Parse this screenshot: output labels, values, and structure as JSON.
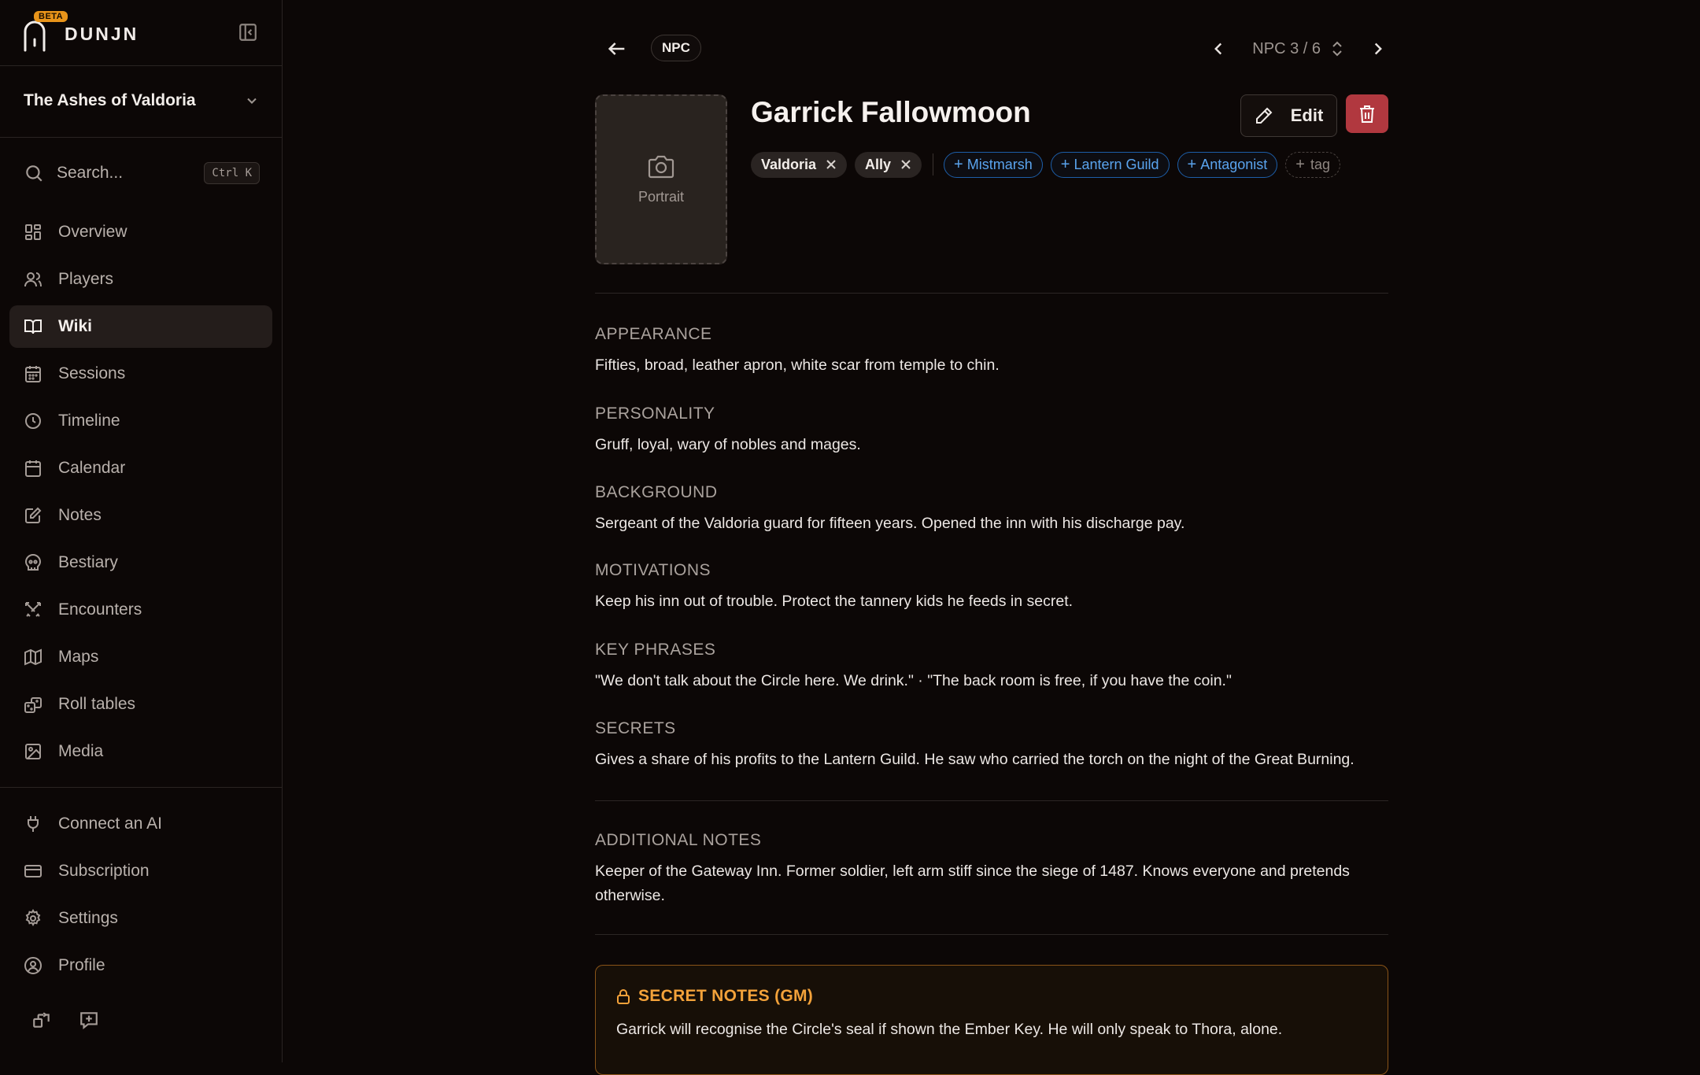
{
  "brand": {
    "name": "DUNJN",
    "badge": "BETA"
  },
  "campaign": {
    "name": "The Ashes of Valdoria"
  },
  "search": {
    "label": "Search...",
    "shortcut": "Ctrl K"
  },
  "nav": {
    "items": [
      {
        "label": "Overview",
        "icon": "grid-icon"
      },
      {
        "label": "Players",
        "icon": "users-icon"
      },
      {
        "label": "Wiki",
        "icon": "book-icon",
        "active": true
      },
      {
        "label": "Sessions",
        "icon": "calendar-days-icon"
      },
      {
        "label": "Timeline",
        "icon": "clock-icon"
      },
      {
        "label": "Calendar",
        "icon": "calendar-icon"
      },
      {
        "label": "Notes",
        "icon": "pencil-square-icon"
      },
      {
        "label": "Bestiary",
        "icon": "skull-icon"
      },
      {
        "label": "Encounters",
        "icon": "crossed-swords-icon"
      },
      {
        "label": "Maps",
        "icon": "map-icon"
      },
      {
        "label": "Roll tables",
        "icon": "dice-icon"
      },
      {
        "label": "Media",
        "icon": "image-icon"
      }
    ],
    "bottom": [
      {
        "label": "Connect an AI",
        "icon": "plug-icon"
      },
      {
        "label": "Subscription",
        "icon": "credit-card-icon"
      },
      {
        "label": "Settings",
        "icon": "gear-icon"
      },
      {
        "label": "Profile",
        "icon": "user-circle-icon"
      }
    ]
  },
  "entry": {
    "type": "NPC",
    "pager": "NPC 3 / 6",
    "title": "Garrick Fallowmoon",
    "portrait_label": "Portrait",
    "edit_label": "Edit",
    "tags": [
      "Valdoria",
      "Ally"
    ],
    "suggested_tags": [
      "Mistmarsh",
      "Lantern Guild",
      "Antagonist"
    ],
    "new_tag_label": "tag",
    "sections": [
      {
        "heading": "APPEARANCE",
        "text": "Fifties, broad, leather apron, white scar from temple to chin."
      },
      {
        "heading": "PERSONALITY",
        "text": "Gruff, loyal, wary of nobles and mages."
      },
      {
        "heading": "BACKGROUND",
        "text": "Sergeant of the Valdoria guard for fifteen years. Opened the inn with his discharge pay."
      },
      {
        "heading": "MOTIVATIONS",
        "text": "Keep his inn out of trouble. Protect the tannery kids he feeds in secret."
      },
      {
        "heading": "KEY PHRASES",
        "text": "\"We don't talk about the Circle here. We drink.\" · \"The back room is free, if you have the coin.\""
      },
      {
        "heading": "SECRETS",
        "text": "Gives a share of his profits to the Lantern Guild. He saw who carried the torch on the night of the Great Burning."
      }
    ],
    "additional_notes": {
      "heading": "ADDITIONAL NOTES",
      "text": "Keeper of the Gateway Inn. Former soldier, left arm stiff since the siege of 1487. Knows everyone and pretends otherwise."
    },
    "secret_notes": {
      "heading": "SECRET NOTES (GM)",
      "text": "Garrick will recognise the Circle's seal if shown the Ember Key. He will only speak to Thora, alone."
    }
  },
  "colors": {
    "accent": "#f3a23a",
    "danger": "#b1383f",
    "link": "#5aa4ee"
  }
}
